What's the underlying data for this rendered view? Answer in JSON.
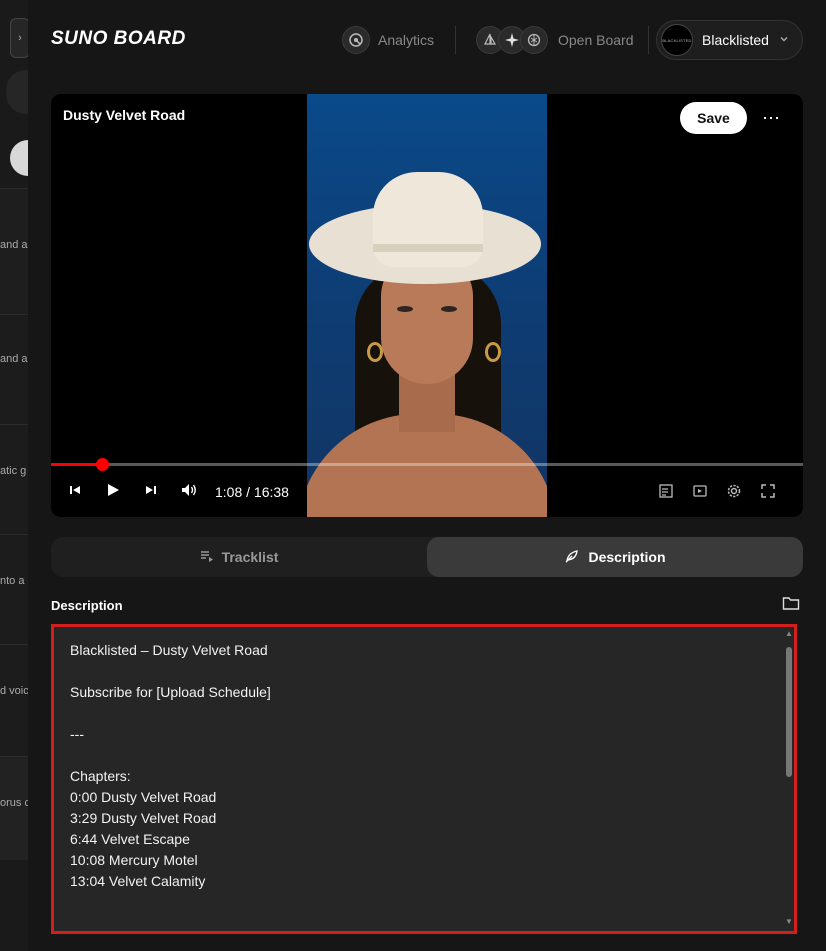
{
  "app": {
    "brand": "SUNO BOARD"
  },
  "nav": {
    "analytics_label": "Analytics",
    "open_board_label": "Open Board",
    "account_name": "Blacklisted",
    "avatar_text": "BLACKLISTED"
  },
  "video": {
    "title": "Dusty Velvet Road",
    "save_label": "Save",
    "more_label": "⋯",
    "time": "1:08 / 16:38",
    "progress_fraction": 0.068
  },
  "tabs": {
    "tracklist_label": "Tracklist",
    "description_label": "Description",
    "active": "description"
  },
  "description": {
    "heading": "Description",
    "lines": [
      "Blacklisted – Dusty Velvet Road",
      "",
      "Subscribe for [Upload Schedule]",
      "",
      "---",
      "",
      "Chapters:",
      "0:00 Dusty Velvet Road",
      "3:29 Dusty Velvet Road",
      "6:44 Velvet Escape",
      "10:08 Mercury Motel",
      "13:04 Velvet Calamity"
    ]
  },
  "colors": {
    "accent_red": "#ff0000",
    "highlight_border": "#d41e1e",
    "background": "#161616"
  },
  "leftpane": {
    "snippets": [
      "and a",
      "and a",
      "atic g",
      "nto a l",
      "d voic",
      "orus c"
    ]
  }
}
